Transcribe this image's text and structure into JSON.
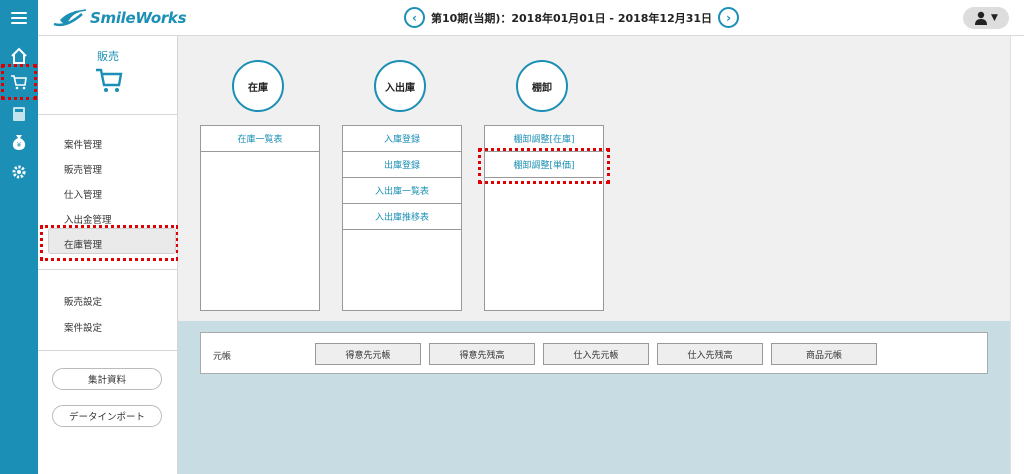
{
  "header": {
    "app_name": "SmileWorks",
    "period_text": "第10期(当期)：2018年01月01日 - 2018年12月31日",
    "prev_icon": "chevron-left-icon",
    "next_icon": "chevron-right-icon",
    "user_icon": "user-icon",
    "dropdown_arrow": "▼"
  },
  "rail": {
    "items": [
      "home-icon",
      "cart-icon",
      "calculator-icon",
      "money-bag-icon",
      "gear-icon"
    ]
  },
  "submenu": {
    "title": "販売",
    "items": [
      "案件管理",
      "販売管理",
      "仕入管理",
      "入出金管理",
      "在庫管理"
    ],
    "settings": [
      "販売設定",
      "案件設定"
    ],
    "buttons": [
      "集計資料",
      "データインポート"
    ]
  },
  "main": {
    "columns": [
      {
        "head": "在庫",
        "rows": [
          "在庫一覧表"
        ]
      },
      {
        "head": "入出庫",
        "rows": [
          "入庫登録",
          "出庫登録",
          "入出庫一覧表",
          "入出庫推移表"
        ]
      },
      {
        "head": "棚卸",
        "rows": [
          "棚卸調整[在庫]",
          "棚卸調整[単価]"
        ]
      }
    ],
    "ledger": {
      "label": "元帳",
      "buttons": [
        "得意先元帳",
        "得意先残高",
        "仕入先元帳",
        "仕入先残高",
        "商品元帳"
      ]
    }
  },
  "colors": {
    "accent": "#1b8fb5",
    "highlight": "#e00000",
    "main_bg": "#f0f0f0",
    "bottom_bg": "#c7dde3"
  }
}
